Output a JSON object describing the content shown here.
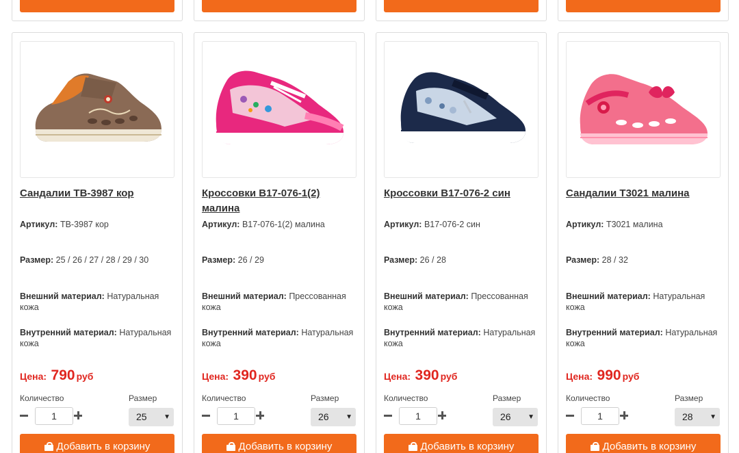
{
  "labels": {
    "article": "Артикул:",
    "size": "Размер:",
    "outer_material": "Внешний материал:",
    "inner_material": "Внутренний материал:",
    "price": "Цена:",
    "currency": "руб",
    "quantity": "Количество",
    "size_select": "Размер",
    "add_to_cart": "Добавить в корзину"
  },
  "colors": {
    "accent": "#f26a1b",
    "price": "#e0261f"
  },
  "icons": {
    "cart": "shopping-bag-icon",
    "minus": "minus-icon",
    "plus": "plus-icon",
    "dropdown": "chevron-down-icon"
  },
  "products": [
    {
      "title": "Сандалии ТВ-3987 кор",
      "article": "ТВ-3987 кор",
      "sizes": "25 / 26 / 27 / 28 / 29 / 30",
      "outer_material": "Натуральная кожа",
      "inner_material": "Натуральная кожа",
      "price": "790",
      "quantity": "1",
      "selected_size": "25"
    },
    {
      "title": "Кроссовки В17-076-1(2) малина",
      "article": "В17-076-1(2) малина",
      "sizes": "26 / 29",
      "outer_material": "Прессованная кожа",
      "inner_material": "Натуральная кожа",
      "price": "390",
      "quantity": "1",
      "selected_size": "26"
    },
    {
      "title": "Кроссовки В17-076-2 син",
      "article": "В17-076-2 син",
      "sizes": "26 / 28",
      "outer_material": "Прессованная кожа",
      "inner_material": "Натуральная кожа",
      "price": "390",
      "quantity": "1",
      "selected_size": "26"
    },
    {
      "title": "Сандалии Т3021 малина",
      "article": "Т3021 малина",
      "sizes": "28 / 32",
      "outer_material": "Натуральная кожа",
      "inner_material": "Натуральная кожа",
      "price": "990",
      "quantity": "1",
      "selected_size": "28"
    }
  ]
}
